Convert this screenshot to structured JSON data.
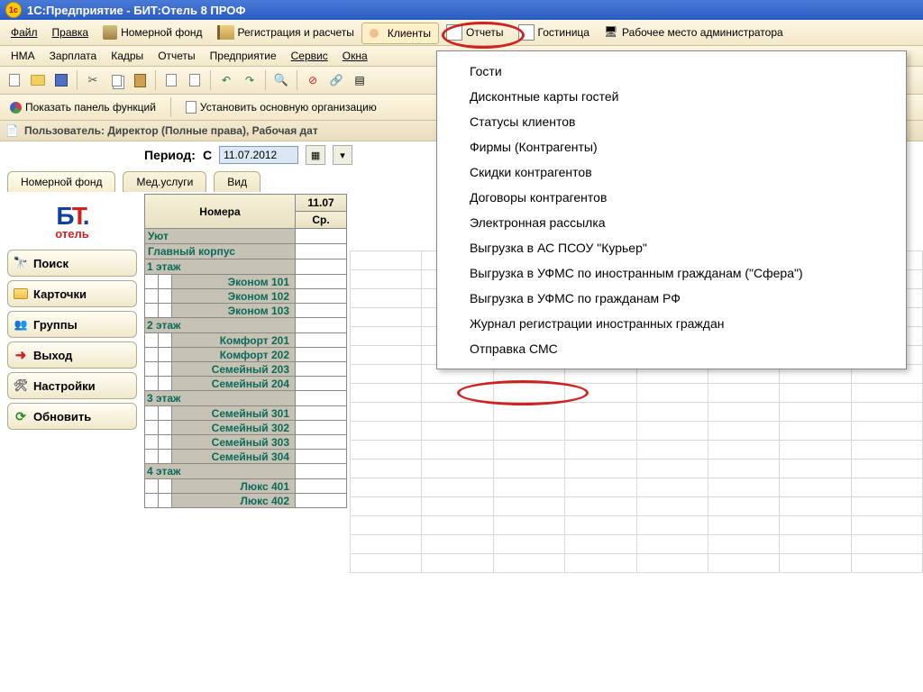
{
  "title": "1С:Предприятие - БИТ:Отель 8 ПРОФ",
  "menu1": {
    "file": "Файл",
    "edit": "Правка",
    "rooms": "Номерной фонд",
    "reg": "Регистрация и расчеты",
    "clients": "Клиенты",
    "reports": "Отчеты",
    "hotel": "Гостиница",
    "admin": "Рабочее место администратора"
  },
  "menu2": {
    "nma": "НМА",
    "salary": "Зарплата",
    "hr": "Кадры",
    "reports": "Отчеты",
    "enterprise": "Предприятие",
    "service": "Сервис",
    "windows": "Окна"
  },
  "row4": {
    "show_panel": "Показать панель функций",
    "set_org": "Установить основную организацию"
  },
  "userbar": "Пользователь: Директор (Полные права), Рабочая дат",
  "period": {
    "label": "Период:",
    "from": "С",
    "date": "11.07.2012"
  },
  "tabs": {
    "rooms": "Номерной фонд",
    "med": "Мед.услуги",
    "view": "Вид"
  },
  "logo": {
    "big": "БТ",
    "sub": "отель"
  },
  "sidebar": {
    "search": "Поиск",
    "cards": "Карточки",
    "groups": "Группы",
    "exit": "Выход",
    "settings": "Настройки",
    "refresh": "Обновить"
  },
  "rooms": {
    "header": "Номера",
    "date": "11.07",
    "day": "Ср.",
    "cat1": "Уют",
    "block1": "Главный корпус",
    "f1": "1 этаж",
    "r101": "Эконом 101",
    "r102": "Эконом 102",
    "r103": "Эконом 103",
    "f2": "2 этаж",
    "r201": "Комфорт 201",
    "r202": "Комфорт 202",
    "r203": "Семейный 203",
    "r204": "Семейный 204",
    "f3": "3 этаж",
    "r301": "Семейный 301",
    "r302": "Семейный 302",
    "r303": "Семейный 303",
    "r304": "Семейный 304",
    "f4": "4 этаж",
    "r401": "Люкс 401",
    "r402": "Люкс 402"
  },
  "dropdown": {
    "guests": "Гости",
    "discount_cards": "Дисконтные карты гостей",
    "client_statuses": "Статусы клиентов",
    "firms": "Фирмы (Контрагенты)",
    "discounts": "Скидки контрагентов",
    "contracts": "Договоры контрагентов",
    "mailing": "Электронная рассылка",
    "export_courier": "Выгрузка в АС ПСОУ \"Курьер\"",
    "export_foreign": "Выгрузка в УФМС по иностранным гражданам (\"Сфера\")",
    "export_rf": "Выгрузка в УФМС по гражданам РФ",
    "journal": "Журнал регистрации иностранных граждан",
    "sms": "Отправка СМС"
  }
}
